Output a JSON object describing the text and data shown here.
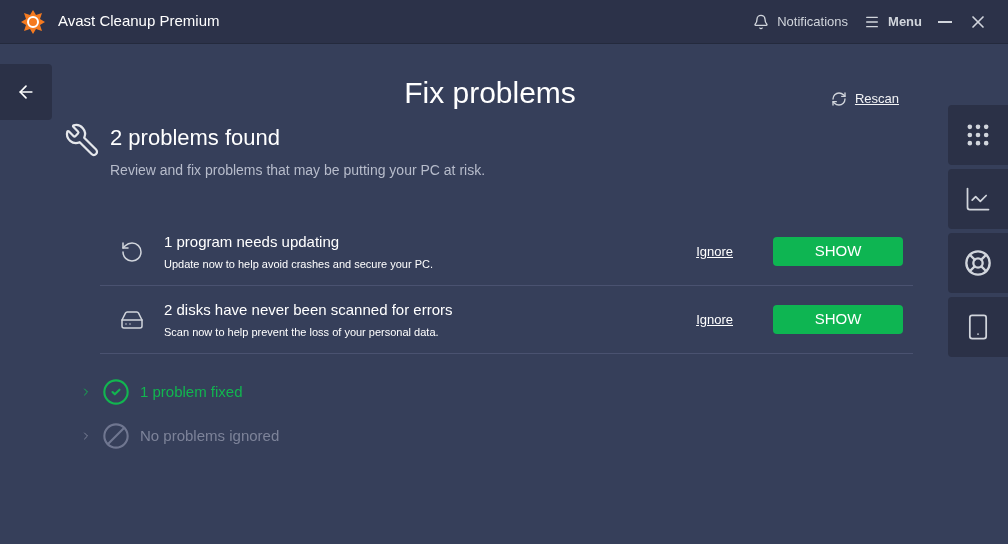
{
  "window": {
    "title": "Avast Cleanup Premium",
    "notifications": "Notifications",
    "menu": "Menu"
  },
  "page": {
    "title": "Fix problems",
    "rescan": "Rescan"
  },
  "summary": {
    "heading": "2 problems found",
    "description": "Review and fix problems that may be putting your PC at risk."
  },
  "problems": [
    {
      "kind": "update",
      "title": "1 program needs updating",
      "description": "Update now to help avoid crashes and secure your PC.",
      "ignore": "Ignore",
      "action": "SHOW"
    },
    {
      "kind": "disk",
      "title": "2 disks have never been scanned for errors",
      "description": "Scan now to help prevent the loss of your personal data.",
      "ignore": "Ignore",
      "action": "SHOW"
    }
  ],
  "sections": [
    {
      "kind": "fixed",
      "label": "1 problem fixed",
      "expanded": false
    },
    {
      "kind": "ignored",
      "label": "No problems ignored",
      "expanded": false
    }
  ],
  "rail": [
    {
      "kind": "grid"
    },
    {
      "kind": "chart"
    },
    {
      "kind": "lifebuoy"
    },
    {
      "kind": "phone"
    }
  ]
}
